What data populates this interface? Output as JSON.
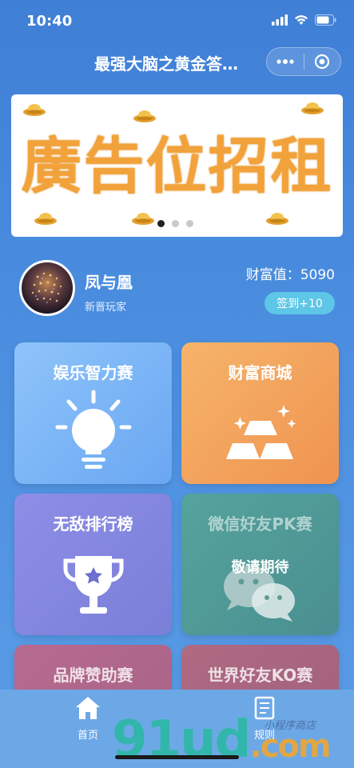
{
  "status_bar": {
    "time": "10:40"
  },
  "navbar": {
    "title": "最强大脑之黄金答…"
  },
  "banner": {
    "text": "廣告位招租",
    "slides": 3,
    "active_slide": 1
  },
  "user": {
    "name": "凤与凰",
    "level": "新晋玩家",
    "wealth_label": "财富值：5090",
    "signin_label": "签到+10"
  },
  "cards": {
    "entertainment": {
      "title": "娱乐智力赛"
    },
    "shop": {
      "title": "财富商城"
    },
    "ranking": {
      "title": "无敌排行榜"
    },
    "wechat_pk": {
      "title": "微信好友PK赛",
      "status": "敬请期待"
    },
    "brand": {
      "title": "品牌赞助赛"
    },
    "world_ko": {
      "title": "世界好友KO赛"
    }
  },
  "tabbar": {
    "home": "首页",
    "rules": "规则"
  },
  "watermark": {
    "main": "91ud",
    "suffix": ".com",
    "sub": "小程序商店"
  },
  "colors": {
    "accent": "#4a8ddf",
    "banner_text": "#f2a23a",
    "signin": "#5ec6e6"
  }
}
